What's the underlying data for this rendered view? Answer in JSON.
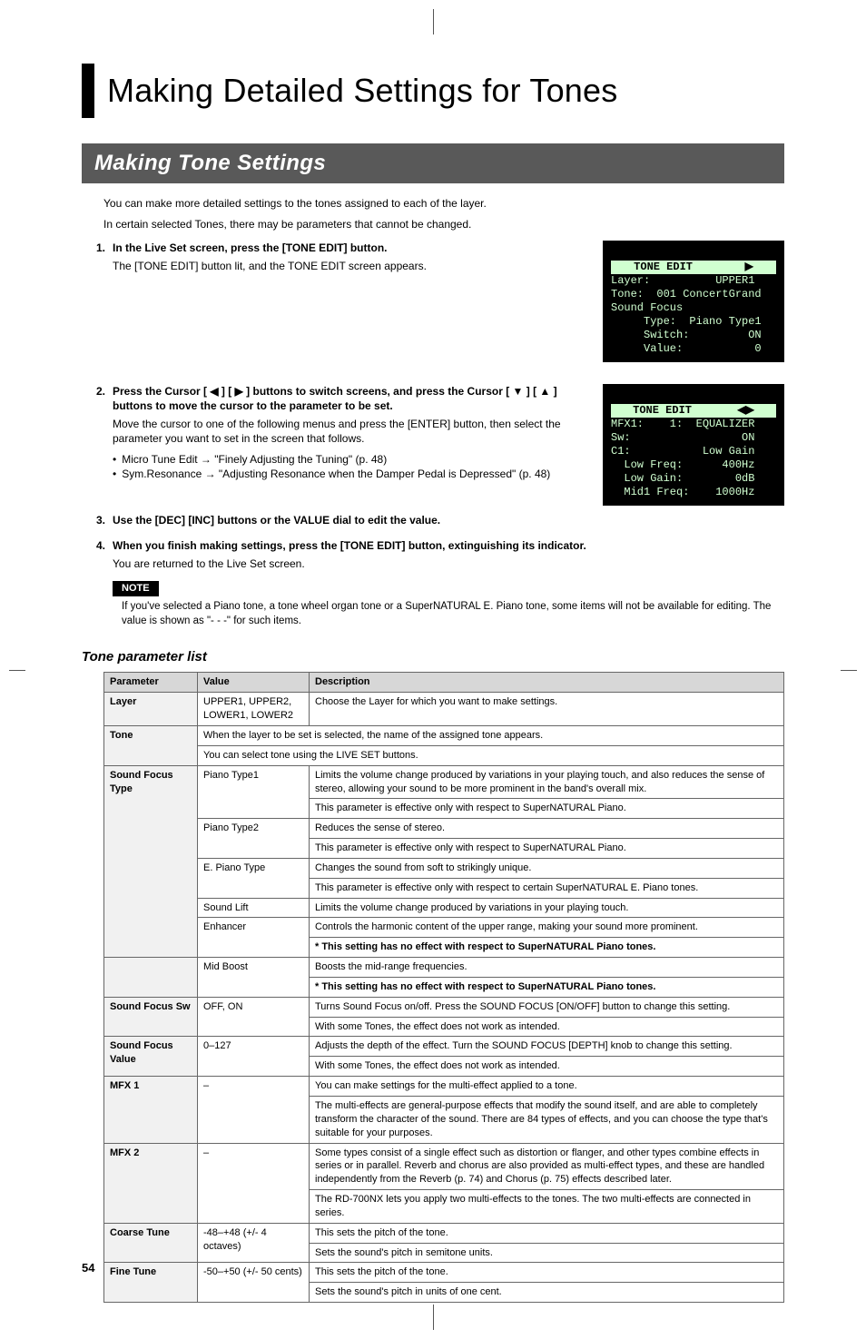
{
  "page_number": "54",
  "title": "Making Detailed Settings for Tones",
  "section_heading": "Making Tone Settings",
  "intro": [
    "You can make more detailed settings to the tones assigned to each of the layer.",
    "In certain selected Tones, there may be parameters that cannot be changed."
  ],
  "steps": [
    {
      "num": "1.",
      "head": "In the Live Set screen, press the [TONE EDIT] button.",
      "body": "The [TONE EDIT] button lit, and the TONE EDIT screen appears."
    },
    {
      "num": "2.",
      "head": "Press the Cursor [ ◀ ] [ ▶ ] buttons to switch screens, and press the Cursor [ ▼ ] [ ▲ ] buttons to move the cursor to the parameter to be set.",
      "body": "Move the cursor to one of the following menus and press the [ENTER] button, then select the parameter you want to set in the screen that follows.",
      "bullets": [
        "Micro Tune Edit → \"Finely Adjusting the Tuning\" (p. 48)",
        "Sym.Resonance → \"Adjusting Resonance when the Damper Pedal is Depressed\" (p. 48)"
      ]
    },
    {
      "num": "3.",
      "head": "Use the [DEC] [INC] buttons or the VALUE dial to edit the value."
    },
    {
      "num": "4.",
      "head": "When you finish making settings, press the [TONE EDIT] button, extinguishing its indicator.",
      "body": "You are returned to the Live Set screen."
    }
  ],
  "note_label": "NOTE",
  "note_text": "If you've selected a Piano tone, a tone wheel organ tone or a SuperNATURAL E. Piano tone, some items will not be available for editing. The value is shown as \"- - -\" for such items.",
  "subhead": "Tone parameter list",
  "table": {
    "headers": [
      "Parameter",
      "Value",
      "Description"
    ],
    "rows": [
      {
        "param": "Layer",
        "value": "UPPER1, UPPER2, LOWER1, LOWER2",
        "desc": [
          "Choose the Layer for which you want to make settings."
        ]
      },
      {
        "param": "Tone",
        "value_colspan_desc": [
          "When the layer to be set is selected, the name of the assigned tone appears.",
          "You can select tone using the LIVE SET buttons."
        ]
      },
      {
        "param": "Sound Focus Type",
        "sub": [
          {
            "v": "Piano Type1",
            "d": [
              "Limits the volume change produced by variations in your playing touch, and also reduces the sense of stereo, allowing your sound to be more prominent in the band's overall mix.",
              "This parameter is effective only with respect to SuperNATURAL Piano."
            ]
          },
          {
            "v": "Piano Type2",
            "d": [
              "Reduces the sense of stereo.",
              "This parameter is effective only with respect to SuperNATURAL Piano."
            ]
          },
          {
            "v": "E. Piano Type",
            "d": [
              "Changes the sound from soft to strikingly unique.",
              "This parameter is effective only with respect to certain SuperNATURAL E. Piano tones."
            ]
          },
          {
            "v": "Sound Lift",
            "d": [
              "Limits the volume change produced by variations in your playing touch."
            ]
          },
          {
            "v": "Enhancer",
            "d": [
              "Controls the harmonic content of the upper range, making your sound more prominent.",
              "*  This setting has no effect with respect to SuperNATURAL Piano tones."
            ]
          },
          {
            "v": "Mid Boost",
            "d": [
              "Boosts the mid-range frequencies.",
              "*  This setting has no effect with respect to SuperNATURAL Piano tones."
            ]
          }
        ]
      },
      {
        "param": "Sound Focus Sw",
        "value": "OFF, ON",
        "desc": [
          "Turns Sound Focus on/off. Press the SOUND FOCUS [ON/OFF] button to change this setting.",
          "With some Tones, the effect does not work as intended."
        ]
      },
      {
        "param": "Sound Focus Value",
        "value": "0–127",
        "desc": [
          "Adjusts the depth of the effect. Turn the SOUND FOCUS [DEPTH] knob to change this setting.",
          "With some Tones, the effect does not work as intended."
        ]
      },
      {
        "param": "MFX 1",
        "value": "–",
        "desc": [
          "You can make settings for the multi-effect applied to a tone.",
          "The multi-effects are general-purpose effects that modify the sound itself, and are able to completely transform the character of the sound. There are 84 types of effects, and you can choose the type that's suitable for your purposes."
        ]
      },
      {
        "param": "MFX 2",
        "value": "–",
        "desc": [
          "Some types consist of a single effect such as distortion or flanger, and other types combine effects in series or in parallel. Reverb and chorus are also provided as multi-effect types, and these are handled independently from the Reverb (p. 74) and Chorus (p. 75) effects described later.",
          "The RD-700NX lets you apply two multi-effects to the tones. The two multi-effects are connected in series."
        ]
      },
      {
        "param": "Coarse Tune",
        "value": "-48–+48 (+/- 4 octaves)",
        "desc": [
          "This sets the pitch of the tone.",
          "Sets the sound's pitch in semitone units."
        ]
      },
      {
        "param": "Fine Tune",
        "value": "-50–+50 (+/- 50 cents)",
        "desc": [
          "This sets the pitch of the tone.",
          "Sets the sound's pitch in units of one cent."
        ]
      }
    ]
  },
  "lcd1": {
    "title": "TONE EDIT        ▶",
    "lines": [
      "Layer:          UPPER1",
      "Tone:  001 ConcertGrand",
      "Sound Focus",
      "     Type:  Piano Type1",
      "     Switch:         ON",
      "     Value:           0"
    ]
  },
  "lcd2": {
    "title": "TONE EDIT       ◀▶",
    "lines": [
      "MFX1:    1:  EQUALIZER",
      "Sw:                 ON",
      "C1:           Low Gain",
      "  Low Freq:      400Hz",
      "  Low Gain:        0dB",
      "  Mid1 Freq:    1000Hz"
    ]
  }
}
